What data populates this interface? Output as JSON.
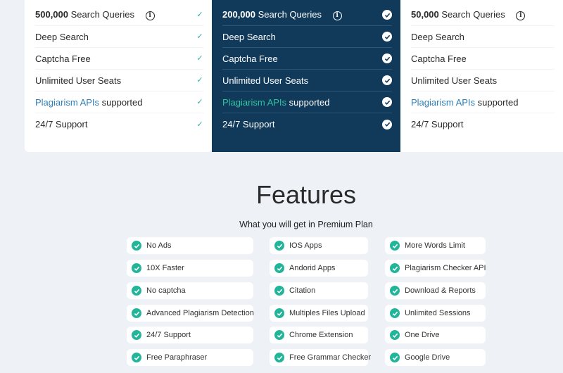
{
  "plans": [
    {
      "queries_number": "500,000",
      "queries_label": "Search Queries",
      "features": [
        "Deep Search",
        "Captcha Free",
        "Unlimited User Seats"
      ],
      "api_link": "Plagiarism APIs",
      "api_suffix": "supported",
      "support": "24/7 Support"
    },
    {
      "queries_number": "200,000",
      "queries_label": "Search Queries",
      "features": [
        "Deep Search",
        "Captcha Free",
        "Unlimited User Seats"
      ],
      "api_link": "Plagiarism APIs",
      "api_suffix": "supported",
      "support": "24/7 Support"
    },
    {
      "queries_number": "50,000",
      "queries_label": "Search Queries",
      "features": [
        "Deep Search",
        "Captcha Free",
        "Unlimited User Seats"
      ],
      "api_link": "Plagiarism APIs",
      "api_suffix": "supported",
      "support": "24/7 Support"
    }
  ],
  "info_glyph": "i",
  "features_section": {
    "title": "Features",
    "subtitle": "What you will get in Premium Plan",
    "columns": [
      [
        "No Ads",
        "10X Faster",
        "No captcha",
        "Advanced Plagiarism Detection",
        "24/7 Support",
        "Free Paraphraser"
      ],
      [
        "IOS Apps",
        "Andorid Apps",
        "Citation",
        "Multiples Files Upload",
        "Chrome Extension",
        "Free Grammar Checker"
      ],
      [
        "More Words Limit",
        "Plagiarism Checker API",
        "Download & Reports",
        "Unlimited Sessions",
        "One Drive",
        "Google Drive"
      ]
    ]
  },
  "colors": {
    "highlight_plan_bg": "#10395a",
    "accent_green": "#22b59a",
    "link_blue": "#2f7fb8",
    "page_bg": "#eef2f7"
  }
}
